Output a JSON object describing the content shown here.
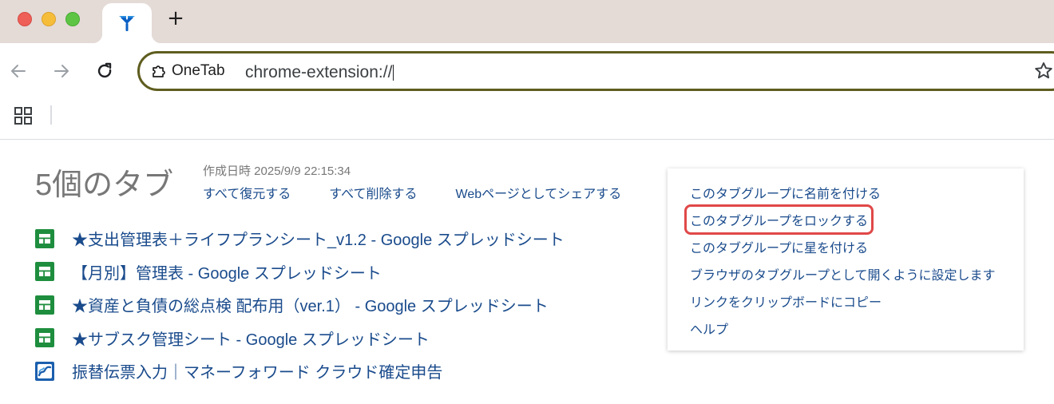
{
  "browser": {
    "new_tab_label": "+",
    "site_chip": "OneTab",
    "url": "chrome-extension://",
    "colors": {
      "titlebar": "#e4dad6",
      "omnibox_border": "#5f5d1f"
    }
  },
  "onetab": {
    "group": {
      "title": "5個のタブ",
      "created": "作成日時 2025/9/9 22:15:34",
      "actions": [
        "すべて復元する",
        "すべて削除する",
        "Webページとしてシェアする"
      ]
    },
    "tabs": [
      {
        "title": "★支出管理表＋ライフプランシート_v1.2 - Google スプレッドシート",
        "icon": "google-sheets-icon"
      },
      {
        "title": "【月別】管理表 - Google スプレッドシート",
        "icon": "google-sheets-icon"
      },
      {
        "title": "★資産と負債の総点検 配布用（ver.1） - Google スプレッドシート",
        "icon": "google-sheets-icon"
      },
      {
        "title": "★サブスク管理シート - Google スプレッドシート",
        "icon": "google-sheets-icon"
      },
      {
        "title": "振替伝票入力｜マネーフォワード クラウド確定申告",
        "icon": "moneyforward-icon"
      }
    ],
    "menu": [
      "このタブグループに名前を付ける",
      "このタブグループをロックする",
      "このタブグループに星を付ける",
      "ブラウザのタブグループとして開くように設定します",
      "リンクをクリップボードにコピー",
      "ヘルプ"
    ],
    "highlighted_menu_item": "このタブグループをロックする",
    "colors": {
      "link": "#1a4b8c",
      "muted": "#777777",
      "highlight_box": "#e04848",
      "sheets_green": "#1e8e3e"
    }
  }
}
